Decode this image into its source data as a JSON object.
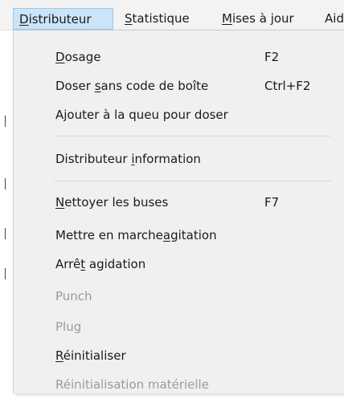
{
  "menubar": {
    "items": [
      {
        "pre": "",
        "ul": "D",
        "post": "istributeur"
      },
      {
        "pre": "",
        "ul": "S",
        "post": "tatistique"
      },
      {
        "pre": "",
        "ul": "M",
        "post": "ises à jour"
      },
      {
        "pre": "Ai",
        "ul": "",
        "post": "d"
      }
    ]
  },
  "menu": {
    "items": [
      {
        "pre": "",
        "ul": "D",
        "post": "osage",
        "shortcut": "F2",
        "enabled": true
      },
      {
        "pre": "Doser ",
        "ul": "s",
        "post": "ans code de boîte",
        "shortcut": "Ctrl+F2",
        "enabled": true
      },
      {
        "pre": "Ajouter à la queu pour doser",
        "ul": "",
        "post": "",
        "shortcut": "",
        "enabled": true
      },
      {
        "pre": "Distributeur ",
        "ul": "i",
        "post": "nformation",
        "shortcut": "",
        "enabled": true
      },
      {
        "pre": "",
        "ul": "N",
        "post": "ettoyer les buses",
        "shortcut": "F7",
        "enabled": true
      },
      {
        "pre": "Mettre en marche",
        "ul": "a",
        "post": "gitation",
        "shortcut": "",
        "enabled": true
      },
      {
        "pre": "Arrê",
        "ul": "t",
        "post": " agidation",
        "shortcut": "",
        "enabled": true
      },
      {
        "pre": "Punch",
        "ul": "",
        "post": "",
        "shortcut": "",
        "enabled": false
      },
      {
        "pre": "Plug",
        "ul": "",
        "post": "",
        "shortcut": "",
        "enabled": false
      },
      {
        "pre": "",
        "ul": "R",
        "post": "éinitialiser",
        "shortcut": "",
        "enabled": true
      },
      {
        "pre": "Réinitialisation matérielle",
        "ul": "",
        "post": "",
        "shortcut": "",
        "enabled": false
      }
    ]
  }
}
